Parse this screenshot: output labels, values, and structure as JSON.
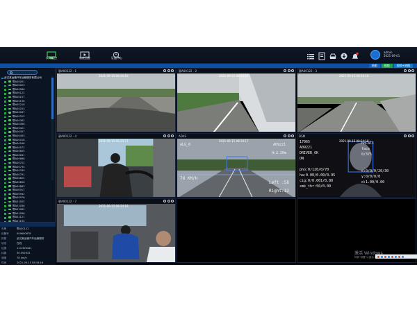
{
  "nav": [
    {
      "label": "实时监控",
      "icon": "monitor-icon",
      "active": true
    },
    {
      "label": "轨迹回放",
      "icon": "playback-icon",
      "active": false
    },
    {
      "label": "证据中心",
      "icon": "evidence-icon",
      "active": false
    }
  ],
  "user": {
    "name": "admin",
    "date": "2021-09-01"
  },
  "strip_buttons": [
    "地图",
    "视频",
    "视频+地图"
  ],
  "sidebar": {
    "company": "武汉某运输汽车运输服务有限公司",
    "vehicles": [
      "鄂A00001",
      "鄂A00023",
      "鄂A00086",
      "鄂A00122",
      "鄂A00157",
      "鄂A00198",
      "鄂A00216",
      "鄂A00253",
      "鄂A00287",
      "鄂A00315",
      "鄂A00362",
      "鄂A00398",
      "鄂A00421",
      "鄂A00457",
      "鄂A00493",
      "鄂A00518",
      "鄂A00546",
      "鄂A00572",
      "鄂A00605",
      "鄂A00631",
      "鄂A00668",
      "鄂A00702",
      "鄂A00735",
      "鄂A00769",
      "鄂A00791",
      "鄂A00824",
      "鄂A00856",
      "鄂A00883",
      "鄂A00917",
      "鄂A00942",
      "鄂A00978",
      "鄂A01005",
      "鄂A01036",
      "鄂A01062",
      "鄂A01098",
      "鄂A01121",
      "鄂A01154"
    ],
    "info": [
      {
        "k": "车牌",
        "v": "鄂A00122"
      },
      {
        "k": "设备号",
        "v": "009600678"
      },
      {
        "k": "所属",
        "v": "武汉某运输汽车运输服务"
      },
      {
        "k": "状态",
        "v": "在线"
      },
      {
        "k": "经度",
        "v": "114.300421"
      },
      {
        "k": "纬度",
        "v": "30.592615"
      },
      {
        "k": "速度",
        "v": "78 km/h"
      },
      {
        "k": "时间",
        "v": "2021-09-15 08:34:16"
      }
    ]
  },
  "cells": [
    {
      "title": "鄂A00122 - 1",
      "osd": "2021-09-15 08:34:16",
      "scene": "road-hood"
    },
    {
      "title": "鄂A00122 - 2",
      "osd": "2021-09-15 08:34:16",
      "scene": "road-side"
    },
    {
      "title": "鄂A00122 - 3",
      "osd": "2021-09-15 08:34:16",
      "scene": "road-rear"
    },
    {
      "title": "鄂A00122 - 4",
      "osd": "2021-09-15 08:34:17",
      "scene": "cab-driver"
    },
    {
      "title": "ADAS",
      "osd": "2021-09-15 08:34:17",
      "scene": "adas",
      "adas": {
        "plate": "A09221",
        "dist": "H:2.20m",
        "speed": "78 KM/H",
        "left": "Left :58",
        "right": "Right:12",
        "alg": "ALG_0"
      }
    },
    {
      "title": "DSM",
      "osd": "2021-09-15 08:34:18",
      "scene": "dsm",
      "dsm": {
        "lines_left": [
          "17065",
          "A09221",
          "DRIVER_OK",
          "ON",
          "",
          "pho:0/120/0/70",
          "ha:0.00/0.00/0.95",
          "cig:0/0.001/0.80",
          "smk_thr:50/0.00"
        ],
        "lines_right": [
          "noCali",
          "face",
          "0/375",
          "",
          "",
          "e:0/0/0/20/30",
          "y:0/0/0/0",
          "d:1.00/0.00"
        ]
      }
    },
    {
      "title": "鄂A00122 - 7",
      "osd": "2021-09-15 08:34:18",
      "scene": "cab-two"
    },
    {
      "title": "",
      "osd": "",
      "scene": "empty"
    },
    {
      "title": "",
      "osd": "",
      "scene": "empty"
    }
  ],
  "watermark": {
    "line1": "激活 Windows",
    "line2": "转到\"设置\"以激活 Windows。"
  },
  "colors": {
    "accent": "#0c4fa4",
    "active_nav": "#37d14a",
    "tree_ok": "#2aa84a"
  }
}
